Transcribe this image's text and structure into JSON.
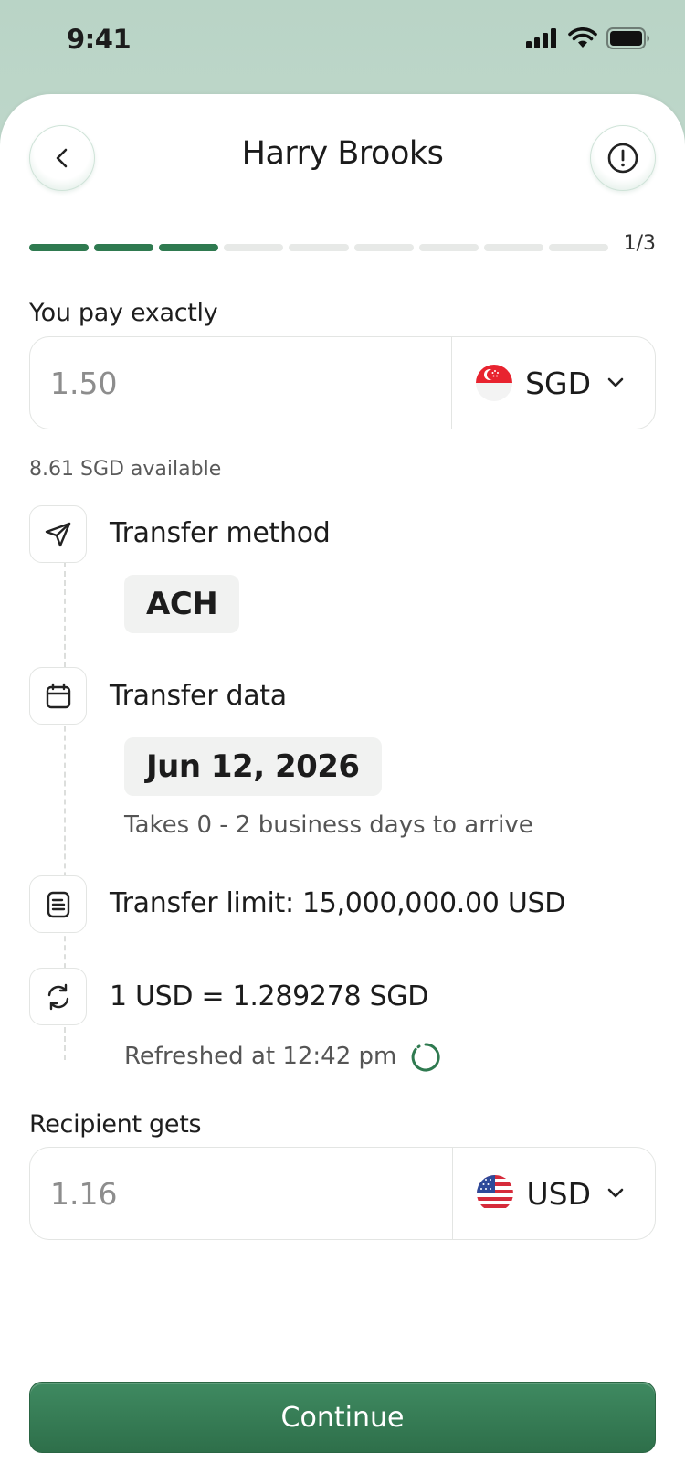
{
  "status_bar": {
    "time": "9:41",
    "icons": [
      "signal-icon",
      "wifi-icon",
      "battery-icon"
    ]
  },
  "header": {
    "title": "Harry Brooks",
    "back_icon": "chevron-left-icon",
    "info_icon": "alert-circle-icon"
  },
  "progress": {
    "segments_total": 9,
    "segments_done": 3,
    "step_label": "1/3",
    "accent_color": "#2f7a50"
  },
  "pay": {
    "label": "You pay exactly",
    "amount": "1.50",
    "currency": "SGD",
    "currency_flag": "singapore-flag-icon",
    "available": "8.61 SGD available"
  },
  "details": {
    "method": {
      "icon": "send-icon",
      "title": "Transfer method",
      "value": "ACH"
    },
    "date": {
      "icon": "calendar-icon",
      "title": "Transfer data",
      "value": "Jun 12, 2026",
      "note": "Takes 0 - 2 business days to arrive"
    },
    "limit": {
      "icon": "document-icon",
      "title": "Transfer limit: 15,000,000.00 USD"
    },
    "rate": {
      "icon": "refresh-icon",
      "title": "1 USD = 1.289278 SGD",
      "refreshed": "Refreshed at 12:42 pm"
    }
  },
  "receive": {
    "label": "Recipient gets",
    "amount": "1.16",
    "currency": "USD",
    "currency_flag": "usa-flag-icon"
  },
  "actions": {
    "continue_label": "Continue"
  }
}
